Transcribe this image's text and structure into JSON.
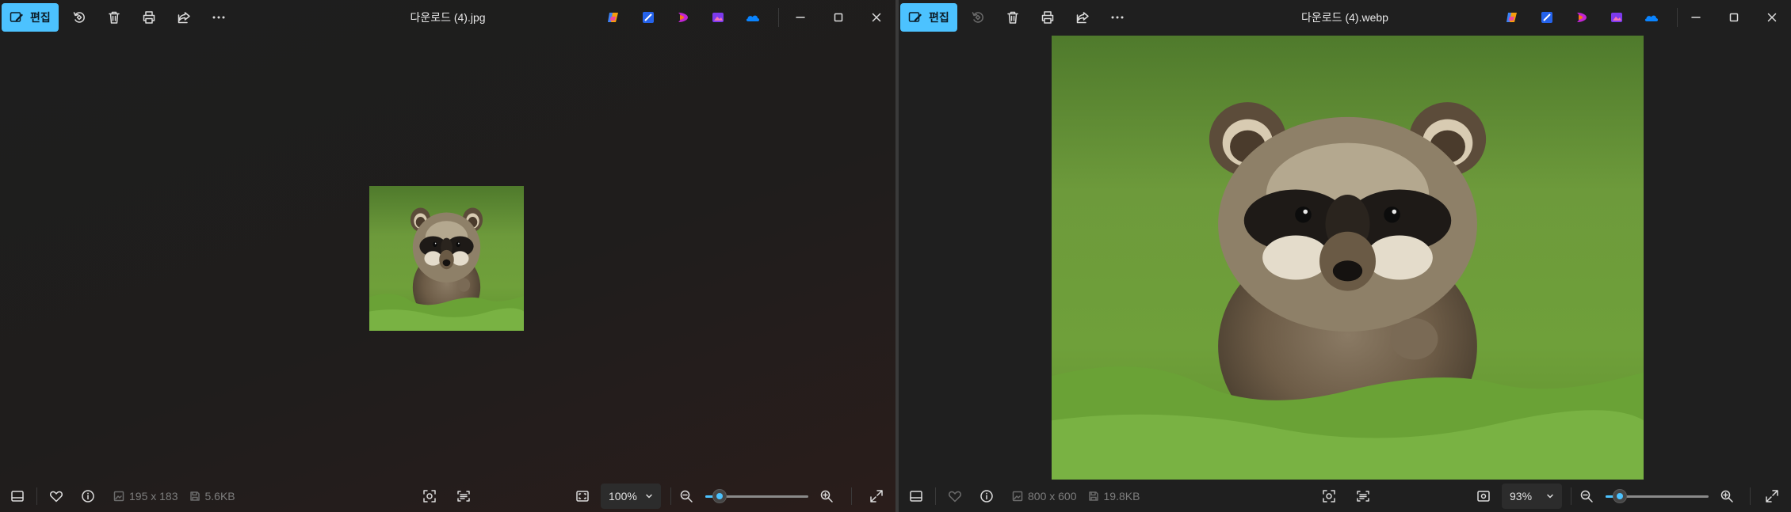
{
  "colors": {
    "accent": "#4cc2ff",
    "background": "#1f1f1f"
  },
  "left_window": {
    "edit_label": "편집",
    "title": "다운로드 (4).jpg",
    "dimensions": "195 x 183",
    "file_size": "5.6KB",
    "zoom": "100%",
    "zoom_slider_fraction": 0.14,
    "favorite_enabled": true,
    "rotate_enabled": true
  },
  "right_window": {
    "edit_label": "편집",
    "title": "다운로드 (4).webp",
    "dimensions": "800 x 600",
    "file_size": "19.8KB",
    "zoom": "93%",
    "zoom_slider_fraction": 0.14,
    "favorite_enabled": false,
    "rotate_enabled": false
  },
  "toolbar_icons": [
    "edit-icon",
    "rotate-icon",
    "delete-icon",
    "print-icon",
    "share-icon",
    "more-icon"
  ],
  "app_icons": [
    "copilot-icon",
    "designer-icon",
    "clipchamp-icon",
    "photos-app-icon",
    "onedrive-icon"
  ],
  "bottom_icons": [
    "filmstrip-icon",
    "heart-icon",
    "info-icon",
    "image-size-icon",
    "file-size-icon",
    "face-scan-icon",
    "text-scan-icon",
    "fit-icon",
    "zoom-out-icon",
    "zoom-in-icon",
    "fullscreen-icon"
  ]
}
